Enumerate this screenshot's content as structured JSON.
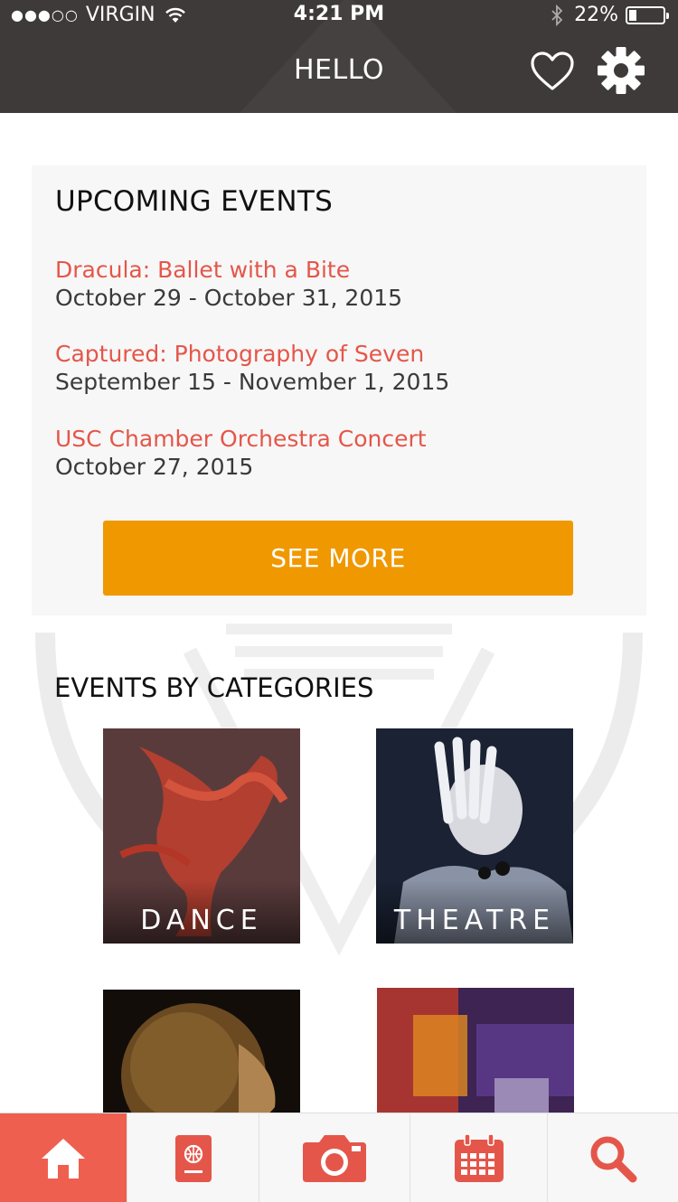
{
  "status_bar": {
    "signal_dots": "●●●○○",
    "carrier": "VIRGIN",
    "time": "4:21 PM",
    "battery_percent": "22%",
    "battery_level": 0.22
  },
  "nav": {
    "title": "HELLO"
  },
  "upcoming": {
    "heading": "UPCOMING EVENTS",
    "events": [
      {
        "title": "Dracula: Ballet with a Bite",
        "dates": "October 29 - October 31, 2015"
      },
      {
        "title": "Captured: Photography of Seven",
        "dates": "September 15 - November 1, 2015"
      },
      {
        "title": "USC Chamber Orchestra Concert",
        "dates": "October 27, 2015"
      }
    ],
    "see_more_label": "SEE MORE"
  },
  "categories": {
    "heading": "EVENTS BY CATEGORIES",
    "tiles": [
      {
        "label": "DANCE"
      },
      {
        "label": "THEATRE"
      },
      {
        "label": ""
      },
      {
        "label": ""
      }
    ]
  },
  "tab_bar": {
    "tabs": [
      {
        "icon": "home-icon",
        "active": true
      },
      {
        "icon": "passport-icon",
        "active": false
      },
      {
        "icon": "camera-icon",
        "active": false
      },
      {
        "icon": "calendar-icon",
        "active": false
      },
      {
        "icon": "search-icon",
        "active": false
      }
    ]
  },
  "colors": {
    "nav_bar": "#3e3a39",
    "accent_red": "#e5564a",
    "button_orange": "#f09800",
    "active_tab": "#ee5f50"
  }
}
